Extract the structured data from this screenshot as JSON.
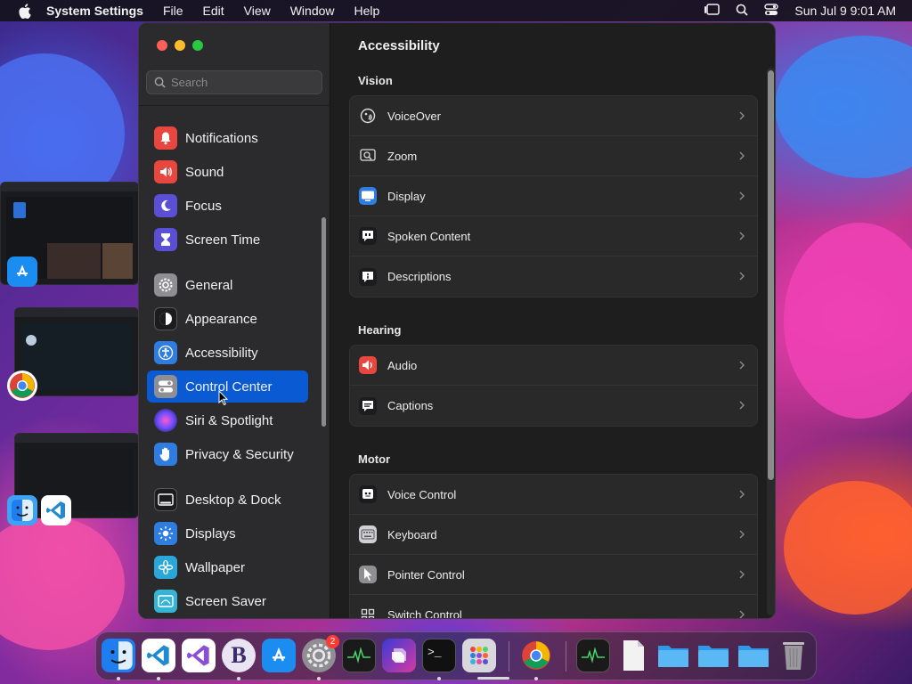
{
  "menubar": {
    "app_name": "System Settings",
    "items": [
      "File",
      "Edit",
      "View",
      "Window",
      "Help"
    ],
    "clock": "Sun Jul 9  9:01 AM"
  },
  "sidebar": {
    "search_placeholder": "Search",
    "items": [
      {
        "label": "Notifications",
        "icon": "bell-icon",
        "color": "#e8473f"
      },
      {
        "label": "Sound",
        "icon": "speaker-icon",
        "color": "#e8473f"
      },
      {
        "label": "Focus",
        "icon": "moon-icon",
        "color": "#5b4fd6"
      },
      {
        "label": "Screen Time",
        "icon": "hourglass-icon",
        "color": "#5b4fd6"
      },
      {
        "label": "General",
        "icon": "gear-icon",
        "color": "#8e8e93"
      },
      {
        "label": "Appearance",
        "icon": "appearance-icon",
        "color": "#1c1c1e"
      },
      {
        "label": "Accessibility",
        "icon": "accessibility-icon",
        "color": "#2f7de1"
      },
      {
        "label": "Control Center",
        "icon": "toggles-icon",
        "color": "#8e8e93"
      },
      {
        "label": "Siri & Spotlight",
        "icon": "siri-icon",
        "color": "#c84fd6"
      },
      {
        "label": "Privacy & Security",
        "icon": "hand-icon",
        "color": "#2f7de1"
      },
      {
        "label": "Desktop & Dock",
        "icon": "dock-icon",
        "color": "#1c1c1e"
      },
      {
        "label": "Displays",
        "icon": "sun-icon",
        "color": "#2f7de1"
      },
      {
        "label": "Wallpaper",
        "icon": "flower-icon",
        "color": "#2aa7d9"
      },
      {
        "label": "Screen Saver",
        "icon": "screensaver-icon",
        "color": "#36b4d6"
      }
    ],
    "selected": "Control Center"
  },
  "content": {
    "title": "Accessibility",
    "sections": [
      {
        "title": "Vision",
        "rows": [
          {
            "label": "VoiceOver",
            "icon": "voiceover-icon"
          },
          {
            "label": "Zoom",
            "icon": "zoom-icon"
          },
          {
            "label": "Display",
            "icon": "display-icon"
          },
          {
            "label": "Spoken Content",
            "icon": "spoken-content-icon"
          },
          {
            "label": "Descriptions",
            "icon": "descriptions-icon"
          }
        ]
      },
      {
        "title": "Hearing",
        "rows": [
          {
            "label": "Audio",
            "icon": "audio-icon"
          },
          {
            "label": "Captions",
            "icon": "captions-icon"
          }
        ]
      },
      {
        "title": "Motor",
        "rows": [
          {
            "label": "Voice Control",
            "icon": "voice-control-icon"
          },
          {
            "label": "Keyboard",
            "icon": "keyboard-icon"
          },
          {
            "label": "Pointer Control",
            "icon": "pointer-icon"
          },
          {
            "label": "Switch Control",
            "icon": "switch-control-icon"
          }
        ]
      }
    ]
  },
  "dock": {
    "apps": [
      "Finder",
      "Visual Studio Code",
      "Visual Studio",
      "BBEdit",
      "App Store",
      "System Settings",
      "Activity Monitor",
      "Shortcuts",
      "Terminal",
      "Launchpad",
      "Chrome",
      "Activity Monitor",
      "Document",
      "Folder",
      "Folder",
      "Folder",
      "Trash"
    ],
    "settings_badge": "2"
  },
  "colors": {
    "accent": "#0a5ad4",
    "window_bg": "#1e1e1e",
    "sidebar_bg": "#2b2a2c"
  }
}
